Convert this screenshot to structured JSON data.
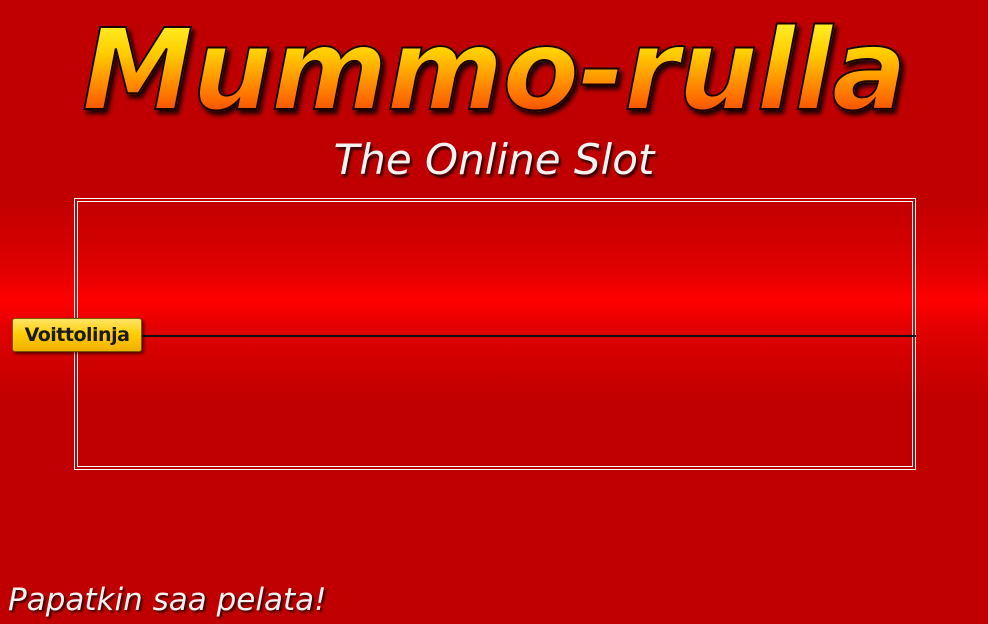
{
  "header": {
    "title": "Mummo-rulla",
    "subtitle": "The Online Slot"
  },
  "slot": {
    "win_line_label": "Voittolinja"
  },
  "footer": {
    "slogan": "Papatkin saa pelata!"
  },
  "colors": {
    "background": "#c00000",
    "background_highlight": "#ff0000",
    "title_gradient_top": "#ffff40",
    "title_gradient_bottom": "#e02000",
    "win_line_label_bg": "#ffcc00",
    "frame_border": "#ffffff",
    "win_line": "#111111"
  }
}
